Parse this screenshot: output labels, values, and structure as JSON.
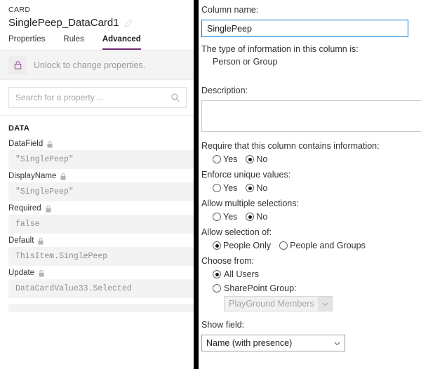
{
  "left_panel": {
    "kicker": "CARD",
    "title": "SinglePeep_DataCard1",
    "edit_icon": "pencil-icon",
    "tabs": [
      {
        "label": "Properties",
        "active": false
      },
      {
        "label": "Rules",
        "active": false
      },
      {
        "label": "Advanced",
        "active": true
      }
    ],
    "lock_bar": {
      "icon": "lock-closed-icon",
      "message": "Unlock to change properties."
    },
    "search": {
      "placeholder": "Search for a property ...",
      "value": "",
      "icon": "search-icon"
    },
    "section_title": "DATA",
    "properties": [
      {
        "label": "DataField",
        "locked": true,
        "value": "\"SinglePeep\""
      },
      {
        "label": "DisplayName",
        "locked": true,
        "value": "\"SinglePeep\""
      },
      {
        "label": "Required",
        "locked": true,
        "value": "false"
      },
      {
        "label": "Default",
        "locked": true,
        "value": "ThisItem.SinglePeep"
      },
      {
        "label": "Update",
        "locked": true,
        "value": "DataCardValue33.Selected"
      }
    ],
    "accent_color": "#742774",
    "tab_underline_color": "#742774"
  },
  "right_panel": {
    "column_name_label": "Column name:",
    "column_name_value": "SinglePeep",
    "type_label": "The type of information in this column is:",
    "type_value": "Person or Group",
    "description_label": "Description:",
    "description_value": "",
    "require_label": "Require that this column contains information:",
    "require_options": [
      {
        "label": "Yes",
        "checked": false
      },
      {
        "label": "No",
        "checked": true
      }
    ],
    "unique_label": "Enforce unique values:",
    "unique_options": [
      {
        "label": "Yes",
        "checked": false
      },
      {
        "label": "No",
        "checked": true
      }
    ],
    "multiple_label": "Allow multiple selections:",
    "multiple_options": [
      {
        "label": "Yes",
        "checked": false
      },
      {
        "label": "No",
        "checked": true
      }
    ],
    "selection_label": "Allow selection of:",
    "selection_options": [
      {
        "label": "People Only",
        "checked": true
      },
      {
        "label": "People and Groups",
        "checked": false
      }
    ],
    "choose_from_label": "Choose from:",
    "choose_from_options": [
      {
        "label": "All Users",
        "checked": true
      },
      {
        "label": "SharePoint Group:",
        "checked": false
      }
    ],
    "sharepoint_group_value": "PlayGround Members",
    "sharepoint_group_disabled": true,
    "show_field_label": "Show field:",
    "show_field_value": "Name (with presence)",
    "focus_border_color": "#0078d7"
  }
}
